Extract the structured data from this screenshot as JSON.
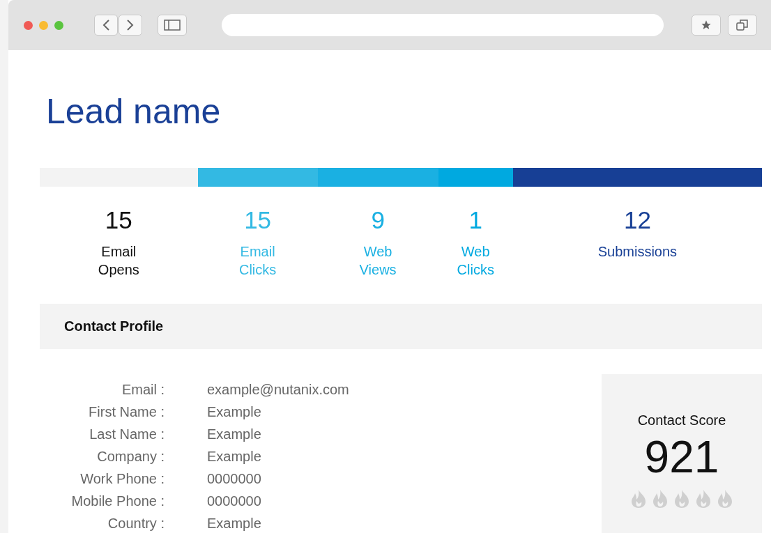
{
  "title": "Lead name",
  "stats": [
    {
      "value": "15",
      "label": "Email Opens",
      "color": "#f3f3f3"
    },
    {
      "value": "15",
      "label": "Email Clicks",
      "color": "#33b9e3"
    },
    {
      "value": "9",
      "label": "Web Views",
      "color": "#1ab0e2"
    },
    {
      "value": "1",
      "label": "Web Clicks",
      "color": "#00a9e0"
    },
    {
      "value": "12",
      "label": "Submissions",
      "color": "#173f95"
    }
  ],
  "profile": {
    "heading": "Contact Profile",
    "fields": [
      {
        "label": "Email :",
        "value": "example@nutanix.com"
      },
      {
        "label": "First Name :",
        "value": "Example"
      },
      {
        "label": "Last Name :",
        "value": "Example"
      },
      {
        "label": "Company :",
        "value": "Example"
      },
      {
        "label": "Work Phone :",
        "value": "0000000"
      },
      {
        "label": "Mobile Phone :",
        "value": "0000000"
      },
      {
        "label": "Country :",
        "value": "Example"
      }
    ]
  },
  "score": {
    "label": "Contact Score",
    "value": "921"
  }
}
